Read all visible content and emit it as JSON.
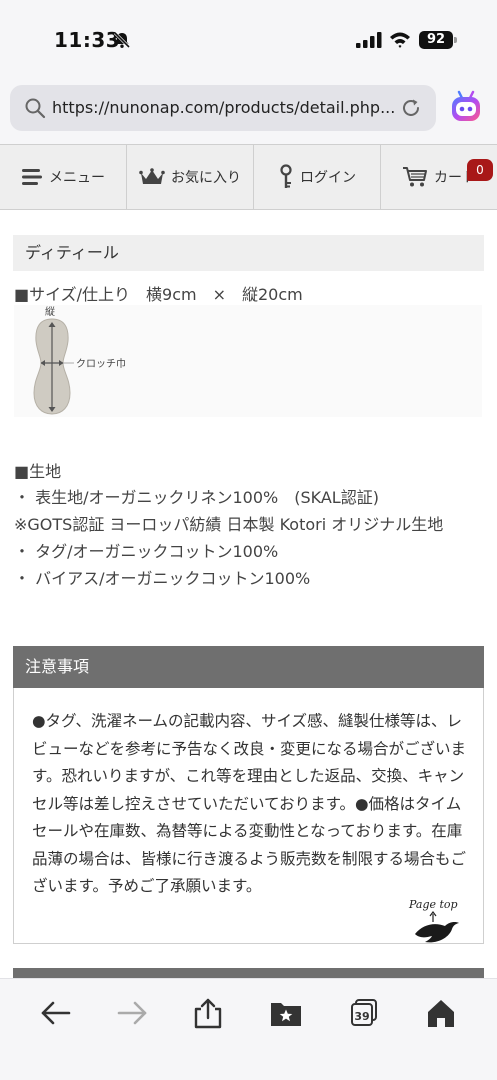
{
  "status": {
    "time": "11:33",
    "battery": "92"
  },
  "browser": {
    "url": "https://nunonap.com/products/detail.php..."
  },
  "nav": {
    "items": [
      {
        "label": "メニュー",
        "icon": "hamburger-icon"
      },
      {
        "label": "お気に入り",
        "icon": "crown-icon"
      },
      {
        "label": "ログイン",
        "icon": "key-icon"
      },
      {
        "label": "カート",
        "icon": "cart-icon"
      }
    ],
    "cart_count": "0"
  },
  "detail": {
    "heading": "ディティール",
    "size_line": "■サイズ/仕上り　横9cm　×　縦20cm",
    "diagram_vertical_label": "縦",
    "diagram_crotch_label": "クロッチ巾"
  },
  "fabric": {
    "title": "■生地",
    "lines": [
      "・ 表生地/オーガニックリネン100%　(SKAL認証)",
      "※GOTS認証 ヨーロッパ紡績 日本製 Kotori オリジナル生地",
      "・ タグ/オーガニックコットン100%",
      "・ バイアス/オーガニックコットン100%"
    ]
  },
  "notice": {
    "heading": "注意事項",
    "body": "●タグ、洗濯ネームの記載内容、サイズ感、縫製仕様等は、レビューなどを参考に予告なく改良・変更になる場合がございます。恐れいりますが、これ等を理由とした返品、交換、キャンセル等は差し控えさせていただいております。●価格はタイムセールや在庫数、為替等による変動性となっております。在庫品薄の場合は、皆様に行き渡るよう販売数を制限する場合もございます。予めご了承願います。"
  },
  "pagetop": {
    "label": "Page top"
  },
  "toolbar": {
    "tabs_count": "39"
  },
  "colors": {
    "notice_header": "#6f6f6f",
    "cart_badge": "#a81818",
    "section_bg": "#efefef"
  }
}
